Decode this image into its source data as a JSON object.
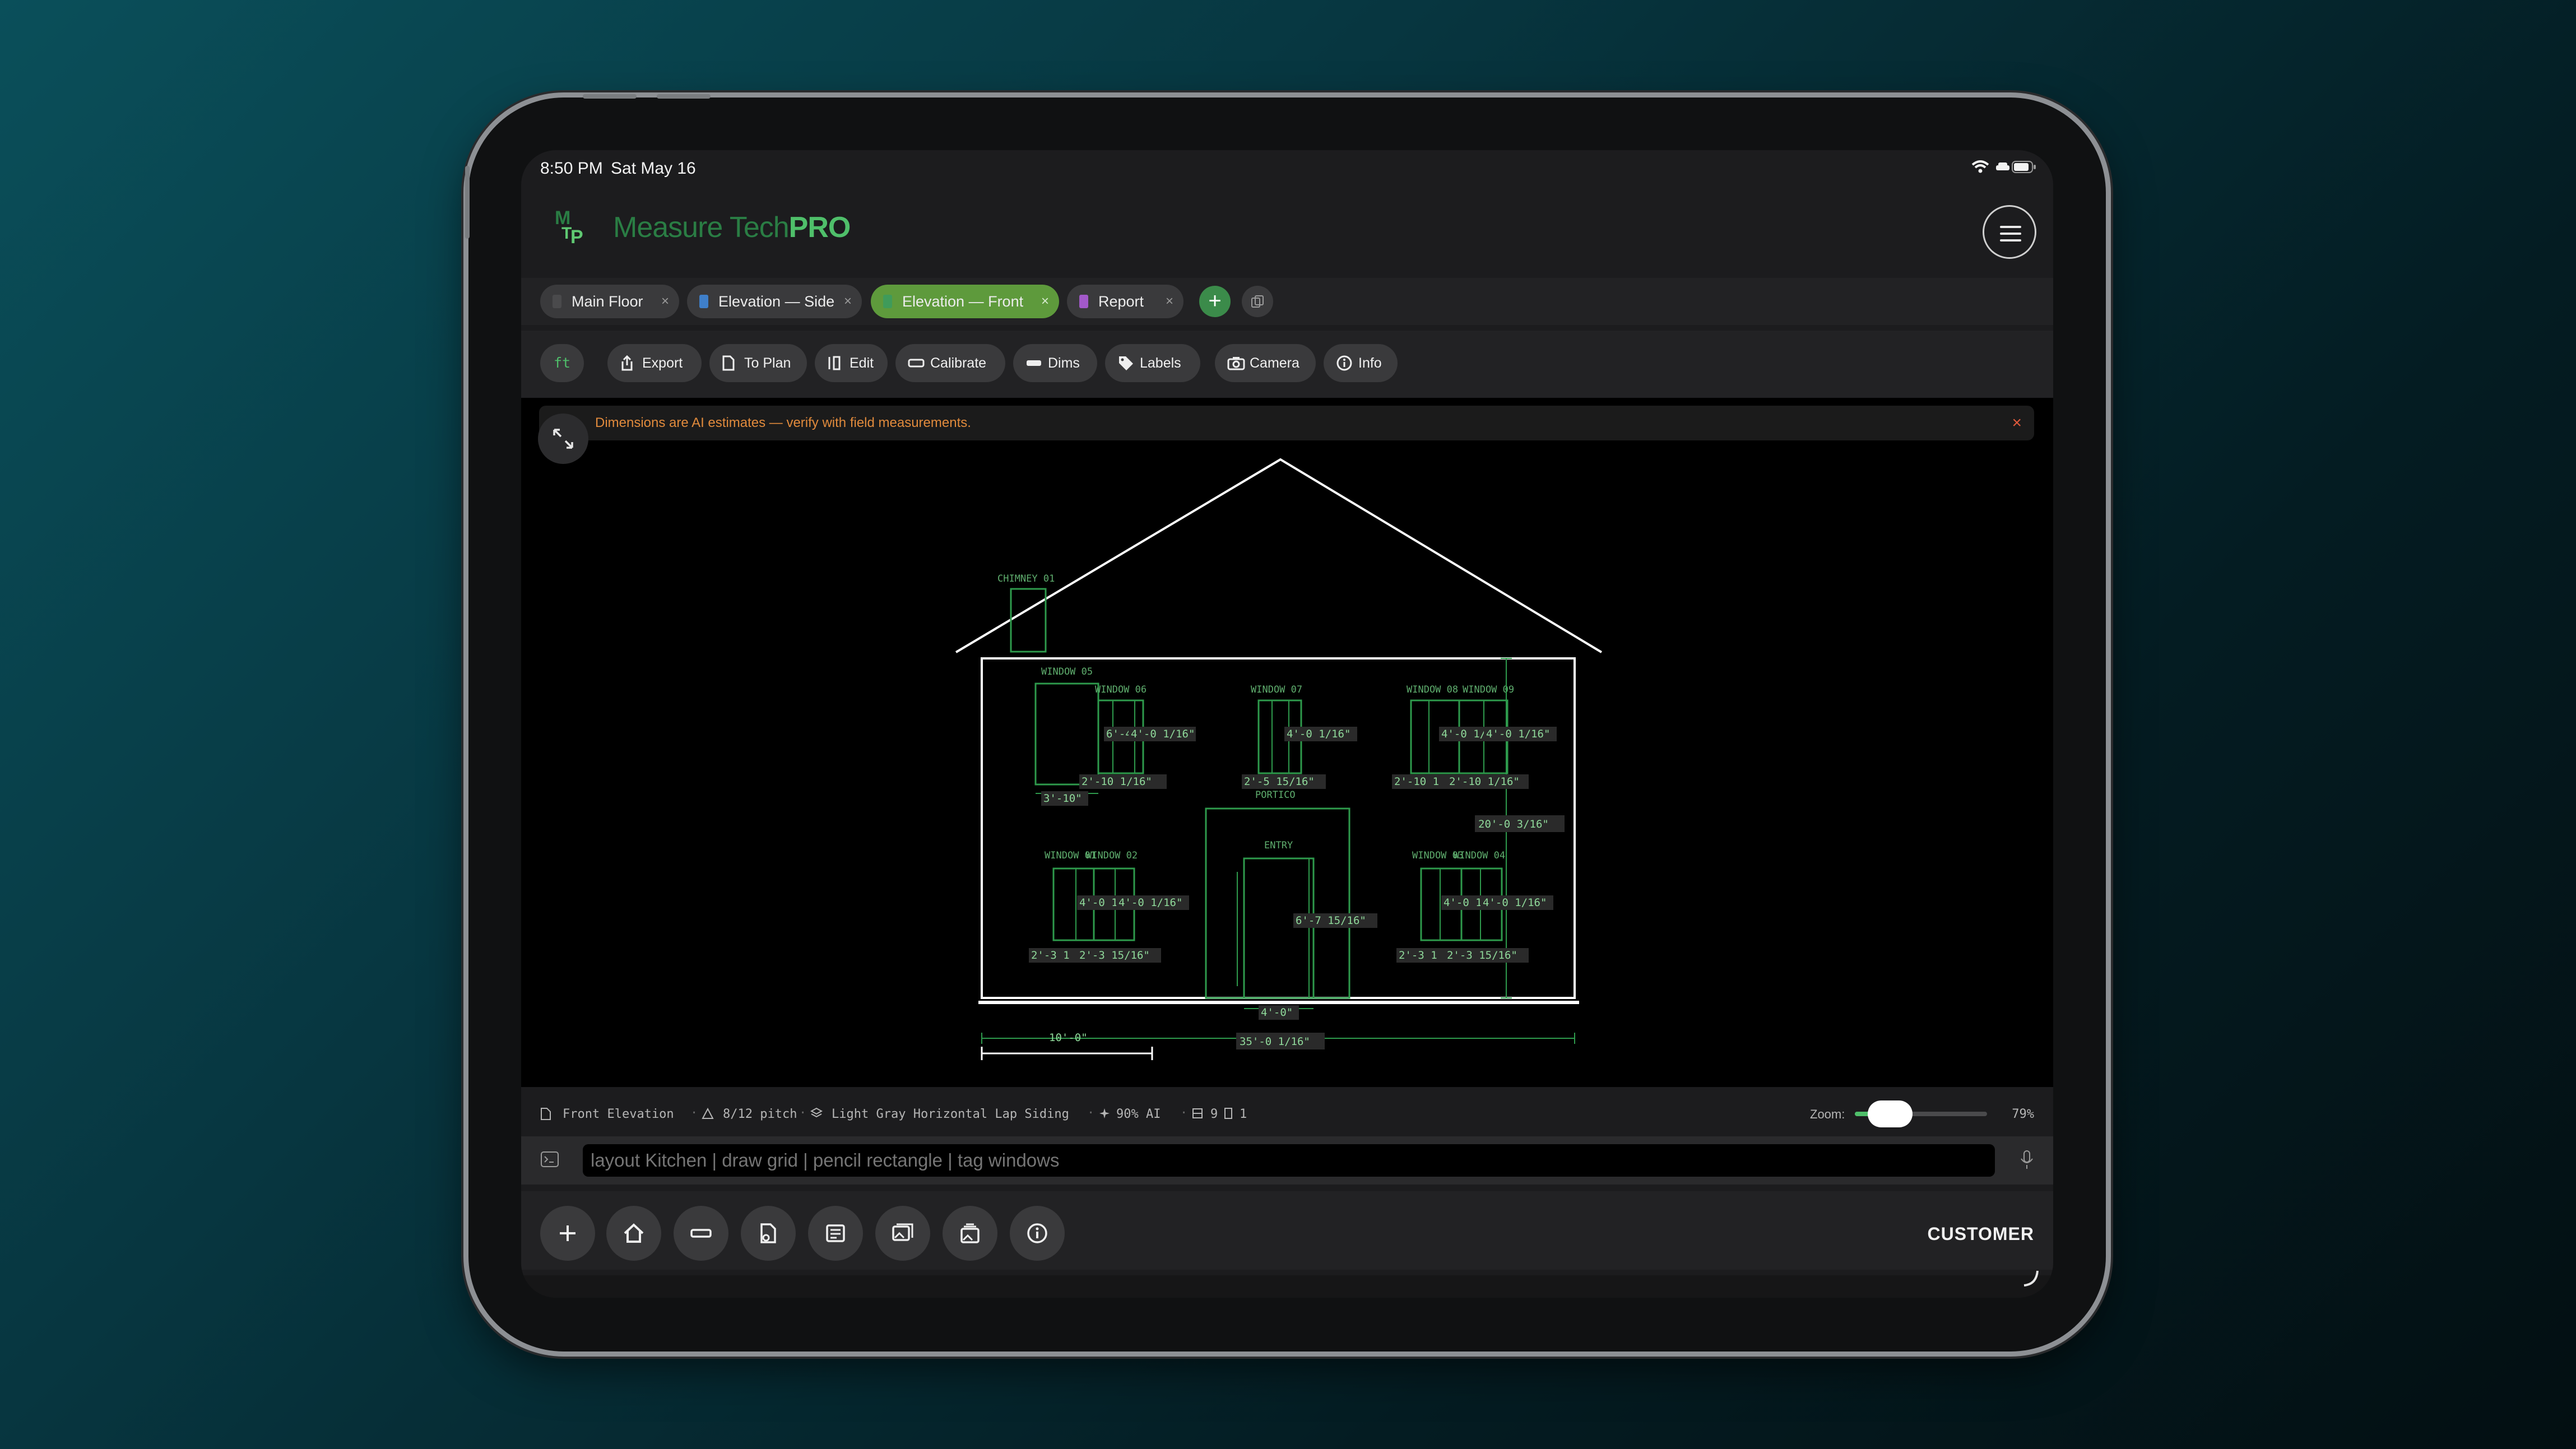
{
  "status": {
    "time": "8:50 PM",
    "date": "Sat May 16"
  },
  "brand": {
    "logo_letters": "MTP",
    "name_a": "Measure Tech",
    "name_b": "PRO"
  },
  "tabs": [
    {
      "label": "Main Floor",
      "color": "#4a4a4c"
    },
    {
      "label": "Elevation — Side",
      "color": "#3f7fc9"
    },
    {
      "label": "Elevation — Front",
      "color": "#3f9b5a"
    },
    {
      "label": "Report",
      "color": "#a259c9"
    }
  ],
  "toolbar": {
    "unit": "ft",
    "export": "Export",
    "to_plan": "To Plan",
    "edit": "Edit",
    "calibrate": "Calibrate",
    "dims": "Dims",
    "labels": "Labels",
    "camera": "Camera",
    "info": "Info"
  },
  "banner": {
    "text": "Dimensions are AI estimates — verify with field measurements.",
    "close": "×"
  },
  "drawing": {
    "chimney": "CHIMNEY 01",
    "w05": "WINDOW 05",
    "w06": "WINDOW 06",
    "w07": "WINDOW 07",
    "w08": "WINDOW 08",
    "w09": "WINDOW 09",
    "w01": "WINDOW 01",
    "w02": "WINDOW 02",
    "w03": "WINDOW 03",
    "w04": "WINDOW 04",
    "portico": "PORTICO",
    "entry": "ENTRY",
    "d_w06_h": "6'-4\"",
    "d_w06_h2": "4'-0 1/16\"",
    "d_w07_h": "4'-0 1/16\"",
    "d_w08_h": "4'-0 1/",
    "d_w09_h": "4'-0 1/16\"",
    "d_w05_w": "3'-10\"",
    "d_w06_w": "2'-10 1/16\"",
    "d_w07_w": "2'-5 15/16\"",
    "d_w08_w": "2'-10 1",
    "d_w09_w": "2'-10 1/16\"",
    "d_w01_h": "4'-0 1",
    "d_w02_h": "4'-0 1/16\"",
    "d_w03_h": "4'-0 1",
    "d_w04_h": "4'-0 1/16\"",
    "d_w01_w": "2'-3 1",
    "d_w02_w": "2'-3 15/16\"",
    "d_w03_w": "2'-3 1",
    "d_w04_w": "2'-3 15/16\"",
    "d_entry_h": "6'-7 15/16\"",
    "d_entry_w": "4'-0\"",
    "d_total_h": "20'-0 3/16\"",
    "d_total_w": "35'-0 1/16\"",
    "scale": "10'-0\""
  },
  "infobar": {
    "view": "Front Elevation",
    "pitch": "8/12 pitch",
    "material": "Light Gray Horizontal Lap Siding",
    "ai": "90% AI",
    "windows": "9",
    "doors": "1",
    "zoom_label": "Zoom:",
    "zoom_value": "79%",
    "zoom_fraction": 0.79
  },
  "command": {
    "placeholder": "layout Kitchen | draw grid | pencil rectangle | tag windows"
  },
  "bottom": {
    "customer": "CUSTOMER"
  }
}
